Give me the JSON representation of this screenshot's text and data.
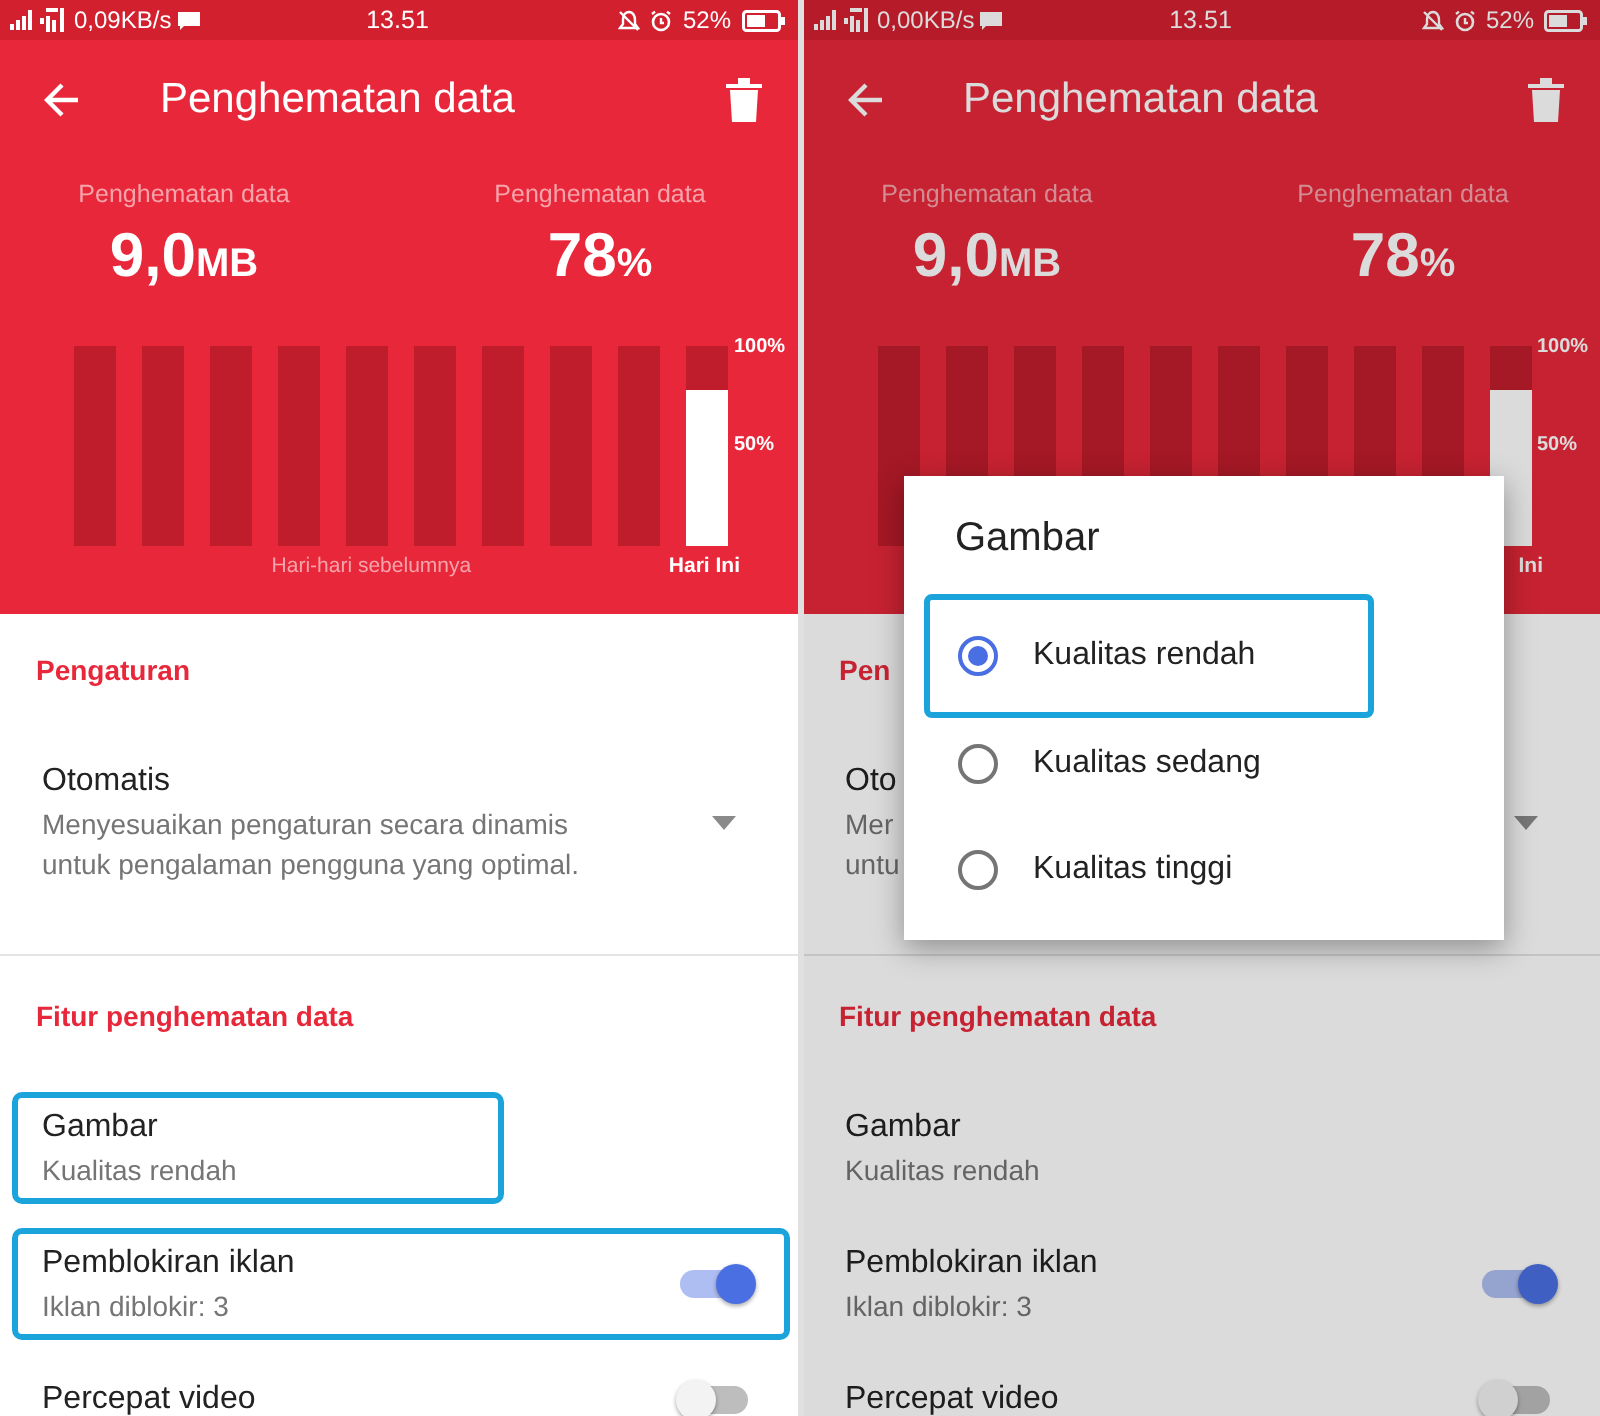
{
  "screens": [
    {
      "dimmed": false,
      "status_bar": {
        "speed": "0,09KB/s",
        "time": "13.51",
        "battery": "52%"
      },
      "toolbar": {
        "title": "Penghematan data"
      },
      "stats": [
        {
          "label": "Penghematan data",
          "value": "9,0",
          "unit": "MB"
        },
        {
          "label": "Penghematan data",
          "value": "78",
          "unit": "%"
        }
      ],
      "chart": {
        "bars": [
          {
            "level": 0
          },
          {
            "level": 0
          },
          {
            "level": 0
          },
          {
            "level": 0
          },
          {
            "level": 0
          },
          {
            "level": 0
          },
          {
            "level": 0
          },
          {
            "level": 0
          },
          {
            "level": 0
          },
          {
            "level": 0.78
          }
        ],
        "ticks": [
          "100%",
          "50%"
        ],
        "past_label": "Hari-hari sebelumnya",
        "today_label": "Hari Ini"
      },
      "sections": [
        {
          "heading": "Pengaturan",
          "items": [
            {
              "kind": "dropdown",
              "title": "Otomatis",
              "description_lines": [
                "Menyesuaikan pengaturan secara dinamis",
                "untuk pengalaman pengguna yang optimal."
              ],
              "highlighted": false
            }
          ]
        },
        {
          "heading": "Fitur penghematan data",
          "items": [
            {
              "kind": "text",
              "title": "Gambar",
              "subtitle": "Kualitas rendah",
              "highlighted": true
            },
            {
              "kind": "toggle",
              "title": "Pemblokiran iklan",
              "subtitle": "Iklan diblokir: 3",
              "on": true,
              "highlighted": true
            },
            {
              "kind": "toggle",
              "title": "Percepat video",
              "on": false,
              "highlighted": false
            }
          ]
        }
      ]
    },
    {
      "dimmed": true,
      "status_bar": {
        "speed": "0,00KB/s",
        "time": "13.51",
        "battery": "52%"
      },
      "toolbar": {
        "title": "Penghematan data"
      },
      "stats": [
        {
          "label": "Penghematan data",
          "value": "9,0",
          "unit": "MB"
        },
        {
          "label": "Penghematan data",
          "value": "78",
          "unit": "%"
        }
      ],
      "chart": {
        "bars": [
          {
            "level": 0
          },
          {
            "level": 0
          },
          {
            "level": 0
          },
          {
            "level": 0
          },
          {
            "level": 0
          },
          {
            "level": 0
          },
          {
            "level": 0
          },
          {
            "level": 0
          },
          {
            "level": 0
          },
          {
            "level": 0.78
          }
        ],
        "ticks": [
          "100%",
          "50%"
        ],
        "today_label": "Ini"
      },
      "sections": [
        {
          "heading": "Pen",
          "items": [
            {
              "kind": "dropdown",
              "title": "Oto",
              "description_lines": [
                "Mer",
                "untu"
              ],
              "highlighted": false
            }
          ]
        },
        {
          "heading": "Fitur penghematan data",
          "items": [
            {
              "kind": "text",
              "title": "Gambar",
              "subtitle": "Kualitas rendah",
              "highlighted": false
            },
            {
              "kind": "toggle",
              "title": "Pemblokiran iklan",
              "subtitle": "Iklan diblokir: 3",
              "on": true,
              "highlighted": false
            },
            {
              "kind": "toggle",
              "title": "Percepat video",
              "on": false,
              "highlighted": false
            }
          ]
        }
      ],
      "dialog": {
        "title": "Gambar",
        "options": [
          {
            "label": "Kualitas rendah",
            "selected": true,
            "highlighted": true
          },
          {
            "label": "Kualitas sedang",
            "selected": false,
            "highlighted": false
          },
          {
            "label": "Kualitas tinggi",
            "selected": false,
            "highlighted": false
          }
        ]
      }
    }
  ]
}
